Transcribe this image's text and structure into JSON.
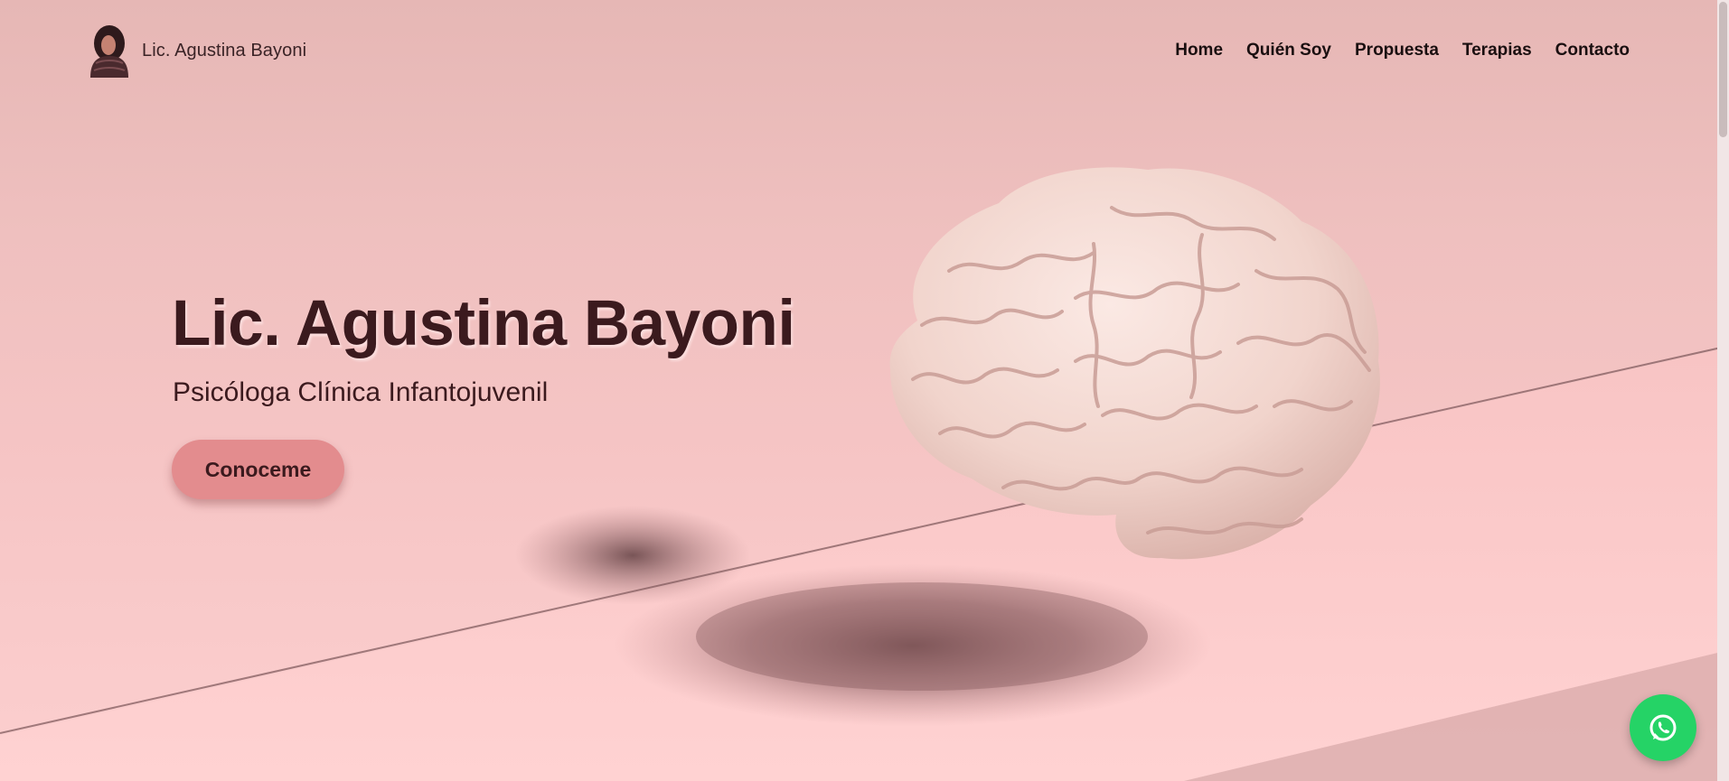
{
  "brand": {
    "name": "Lic. Agustina Bayoni",
    "logo_icon": "woman-portrait-logo-icon"
  },
  "nav": {
    "items": [
      {
        "label": "Home"
      },
      {
        "label": "Quién Soy"
      },
      {
        "label": "Propuesta"
      },
      {
        "label": "Terapias"
      },
      {
        "label": "Contacto"
      }
    ]
  },
  "hero": {
    "title": "Lic. Agustina Bayoni",
    "subtitle": "Psicóloga Clínica Infantojuvenil",
    "cta_label": "Conoceme",
    "image_icon": "brain-illustration"
  },
  "whatsapp": {
    "icon": "whatsapp-icon"
  },
  "colors": {
    "accent": "#e38c8e",
    "text_dark": "#3b1a1e",
    "background": "#f6c5c5",
    "whatsapp_green": "#25d366"
  }
}
